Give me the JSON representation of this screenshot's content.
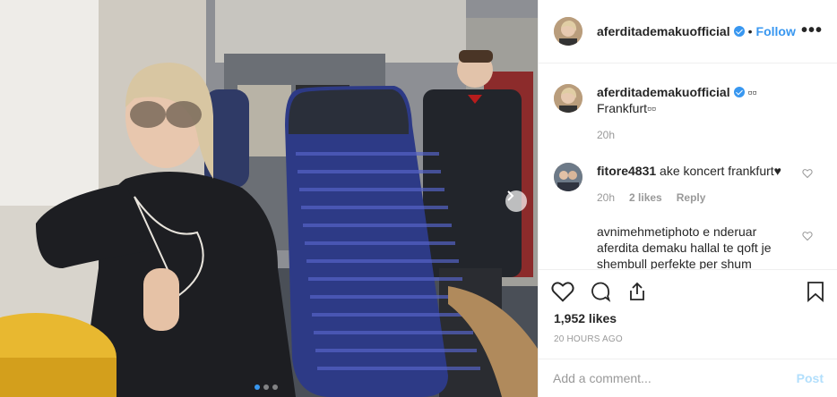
{
  "post": {
    "username": "aferditademakuofficial",
    "separator": "•",
    "follow_label": "Follow",
    "more_label": "•••",
    "verified_icon": "verified-badge-icon",
    "caption": {
      "username": "aferditademakuofficial",
      "emoji": "▫▫",
      "text": "Frankfurt▫▫",
      "time": "20h"
    },
    "comments": [
      {
        "username": "fitore4831",
        "text": "ake koncert frankfurt♥",
        "time": "20h",
        "likes": "2 likes",
        "reply_label": "Reply"
      },
      {
        "username": "avnimehmetiphoto",
        "text": "e nderuar aferdita demaku hallal te qoft je shembull perfekte per shum"
      }
    ],
    "likes": "1,952 likes",
    "time_ago": "20 HOURS AGO",
    "comment_placeholder": "Add a comment...",
    "post_label": "Post",
    "carousel": {
      "total": 3,
      "active": 1
    },
    "colors": {
      "accent": "#3897f0",
      "text": "#262626",
      "muted": "#999999",
      "post_disabled": "#b2dffc"
    }
  }
}
